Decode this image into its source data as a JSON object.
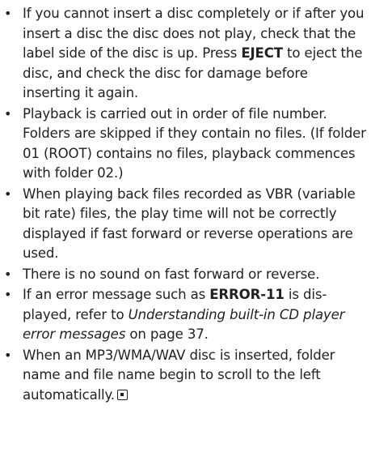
{
  "bullet_glyph": "•",
  "items": [
    {
      "t1": "If you cannot insert a disc completely or if after you insert a disc the disc does not play, check that the label side of the disc is up. Press ",
      "b1": "EJECT",
      "t2": " to eject the disc, and check the disc for damage before inserting it again."
    },
    {
      "t1": "Playback is carried out in order of file number. Folders are skipped if they contain no files. (If folder 01 (ROOT) contains no files, playback commences with folder 02.)"
    },
    {
      "t1": "When playing back files recorded as VBR (variable bit rate) files, the play time will not be correctly displayed if fast forward or reverse operations are used."
    },
    {
      "t1": "There is no sound on fast forward or reverse."
    },
    {
      "t1": "If an error message such as ",
      "b1": "ERROR-11",
      "t2": " is dis-played, refer to ",
      "i1": "Understanding built-in CD player error messages",
      "t3": " on page 37."
    },
    {
      "t1": "When an MP3/WMA/WAV disc is inserted, folder name and file name begin to scroll to the left automatically."
    }
  ]
}
